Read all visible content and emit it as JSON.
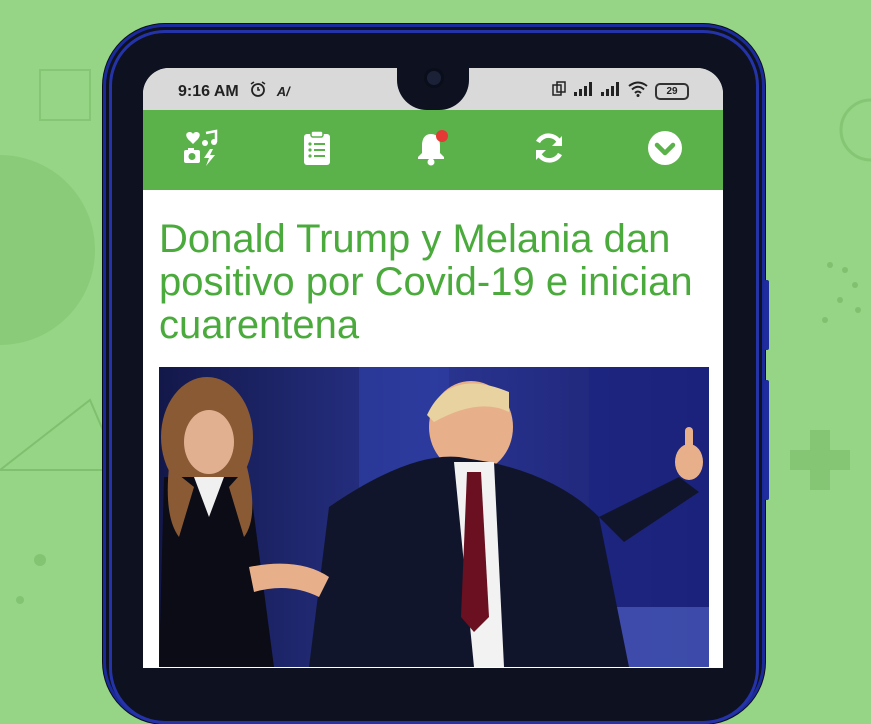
{
  "status_bar": {
    "time": "9:16 AM",
    "battery": "29",
    "icons": [
      "alarm-icon",
      "accessibility-icon",
      "dual-sim-icon",
      "signal-icon",
      "signal-icon",
      "wifi-icon",
      "battery-icon"
    ]
  },
  "toolbar": {
    "buttons": [
      {
        "icon": "media-categories-icon"
      },
      {
        "icon": "clipboard-list-icon"
      },
      {
        "icon": "notification-bell-icon",
        "has_badge": true
      },
      {
        "icon": "refresh-icon"
      },
      {
        "icon": "chevron-down-circle-icon"
      }
    ]
  },
  "article": {
    "title": "Donald Trump y Melania dan positivo por Covid-19 e inician cuarentena",
    "image_description": "Donald Trump with raised thumb next to Melania Trump"
  },
  "colors": {
    "background": "#96d486",
    "toolbar": "#5bb14a",
    "headline": "#4aab3c",
    "badge": "#e53935",
    "phone_frame": "#1e2c9e"
  }
}
